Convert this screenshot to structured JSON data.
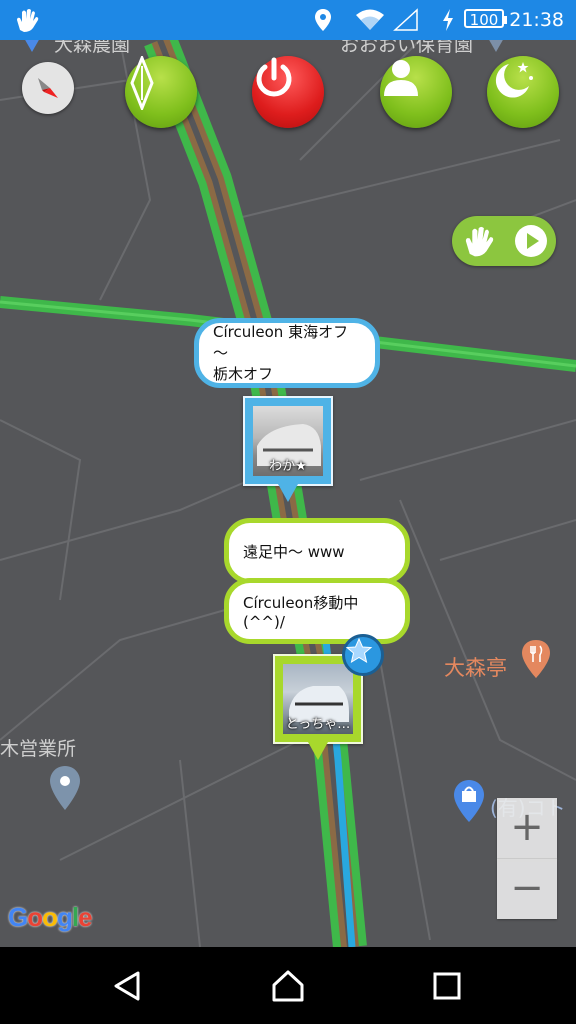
{
  "status_bar": {
    "battery": "100",
    "time": "21:38",
    "icons": [
      "hand-app-icon",
      "location-icon",
      "wifi-icon",
      "signal-icon",
      "charging-icon"
    ]
  },
  "map": {
    "labels": {
      "top_left": "大森農園",
      "top_right": "おおおい保育園",
      "restaurant": "大森亭",
      "office": "木営業所",
      "shop": "(有)コト"
    },
    "attribution": "Google"
  },
  "toolbar": {
    "buttons": [
      "compass-button",
      "navigation-button",
      "power-button",
      "profile-button",
      "night-mode-button"
    ]
  },
  "markers": [
    {
      "bubble": "Círculeon 東海オフ～栃木オフ",
      "bubble_line1": "Círculeon 東海オフ～",
      "bubble_line2": "栃木オフ",
      "label": "わか★",
      "color": "#4fb3e6"
    },
    {
      "bubble_1": "遠足中～ www",
      "bubble_2": "Círculeon移動中(^^)/",
      "label": "とっちゃ…",
      "color": "#a8d82c",
      "starred": true
    }
  ],
  "zoom": {
    "in": "+",
    "out": "−"
  },
  "colors": {
    "status_bar": "#1e88e5",
    "map_bg": "#555659",
    "road_green": "#3fb84a",
    "road_brown": "#8b6a45",
    "accent_green": "#8cc63f",
    "power_red": "#de1d1d"
  }
}
